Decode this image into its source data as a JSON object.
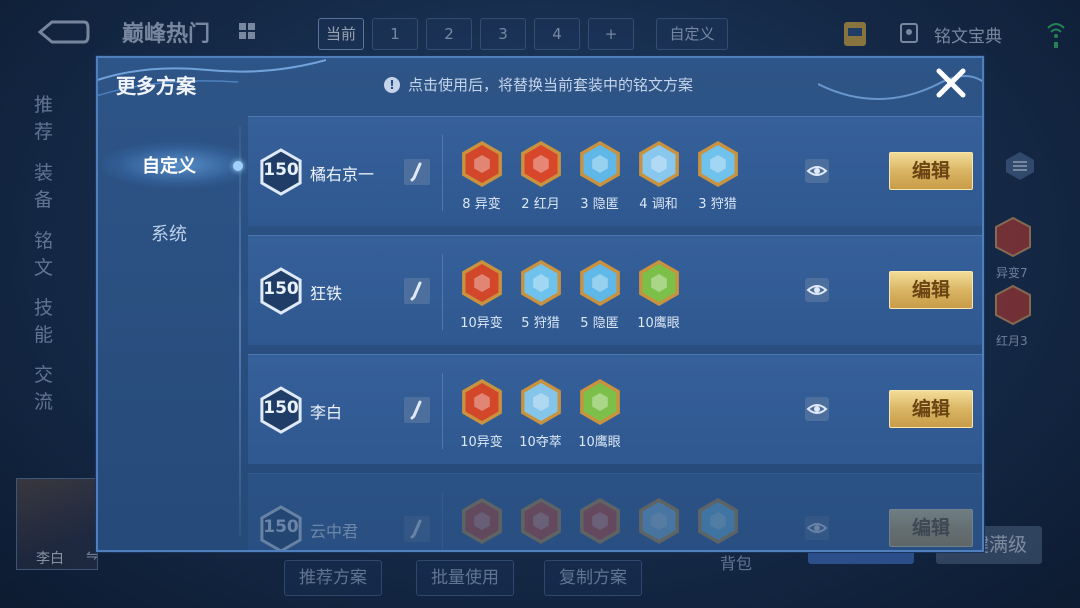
{
  "background": {
    "peak_title": "巅峰热门",
    "slot_tabs": [
      "当前",
      "1",
      "2",
      "3",
      "4",
      "+",
      "自定义"
    ],
    "rune_dict_label": "铭文宝典",
    "left_nav": [
      "推荐",
      "装备",
      "铭文",
      "技能",
      "交流"
    ],
    "hero_name": "李白",
    "swap_symbol": "⇋",
    "bottom_buttons": [
      "推荐方案",
      "批量使用",
      "复制方案"
    ],
    "bag_label": "背包",
    "max_level_label": "一键满级",
    "right_runes": [
      "异变7",
      "红月3"
    ]
  },
  "modal": {
    "title": "更多方案",
    "notice": "点击使用后，将替换当前套装中的铭文方案",
    "side_tabs": [
      "自定义",
      "系统"
    ],
    "edit_label": "编辑",
    "plans": [
      {
        "level": "150",
        "name": "橘右京一",
        "runes": [
          {
            "label": "8 异变",
            "icon": "rune-yibian-icon",
            "color": "#d2462a"
          },
          {
            "label": "2 红月",
            "icon": "rune-hongyue-icon",
            "color": "#d9472b"
          },
          {
            "label": "3 隐匿",
            "icon": "rune-yinni-icon",
            "color": "#5fb8e8"
          },
          {
            "label": "4 调和",
            "icon": "rune-tiaohe-icon",
            "color": "#88c7ee"
          },
          {
            "label": "3 狩猎",
            "icon": "rune-shoulie-icon",
            "color": "#6fc2ec"
          }
        ]
      },
      {
        "level": "150",
        "name": "狂铁",
        "runes": [
          {
            "label": "10异变",
            "icon": "rune-yibian-icon",
            "color": "#d2462a"
          },
          {
            "label": "5 狩猎",
            "icon": "rune-shoulie-icon",
            "color": "#6fc2ec"
          },
          {
            "label": "5 隐匿",
            "icon": "rune-yinni-icon",
            "color": "#5fb8e8"
          },
          {
            "label": "10鹰眼",
            "icon": "rune-yingyan-icon",
            "color": "#7cc04a"
          }
        ]
      },
      {
        "level": "150",
        "name": "李白",
        "runes": [
          {
            "label": "10异变",
            "icon": "rune-yibian-icon",
            "color": "#d2462a"
          },
          {
            "label": "10夺萃",
            "icon": "rune-duocui-icon",
            "color": "#86c5ea"
          },
          {
            "label": "10鹰眼",
            "icon": "rune-yingyan-icon",
            "color": "#7cc04a"
          }
        ]
      },
      {
        "level": "150",
        "name": "云中君",
        "runes": [
          {
            "label": "",
            "icon": "rune-yibian-icon",
            "color": "#d2462a"
          },
          {
            "label": "",
            "icon": "rune-red-icon",
            "color": "#d9472b"
          },
          {
            "label": "",
            "icon": "rune-hongyue-icon",
            "color": "#d9472b"
          },
          {
            "label": "",
            "icon": "rune-duocui-icon",
            "color": "#86c5ea"
          },
          {
            "label": "",
            "icon": "rune-shoulie-icon",
            "color": "#6fc2ec"
          }
        ]
      }
    ]
  }
}
